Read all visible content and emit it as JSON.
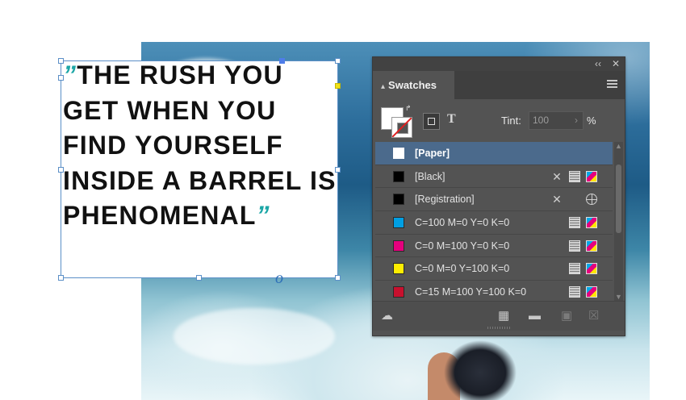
{
  "quote": {
    "open_mark": "”",
    "line1": "THE RUSH YOU",
    "line2": "GET WHEN YOU",
    "line3": "FIND YOURSELF",
    "line4": "INSIDE A BARREL IS",
    "line5": "PHENOMENAL",
    "close_mark": "”",
    "overset_glyph": "o"
  },
  "panel": {
    "title": "Swatches",
    "tint_label": "Tint:",
    "tint_value": "100",
    "tint_unit": "%",
    "text_format_glyph": "T",
    "collapse_glyph": "‹‹",
    "close_glyph": "✕"
  },
  "swatches": [
    {
      "name": "[Paper]",
      "color": "#ffffff",
      "selected": true,
      "icons": []
    },
    {
      "name": "[Black]",
      "color": "#000000",
      "selected": false,
      "icons": [
        "no-edit-icon",
        "process-icon",
        "cmyk-icon"
      ]
    },
    {
      "name": "[Registration]",
      "color": "#000000",
      "selected": false,
      "icons": [
        "no-edit-icon",
        "registration-icon"
      ]
    },
    {
      "name": "C=100 M=0 Y=0 K=0",
      "color": "#009fe3",
      "selected": false,
      "icons": [
        "process-icon",
        "cmyk-icon"
      ]
    },
    {
      "name": "C=0 M=100 Y=0 K=0",
      "color": "#e5007d",
      "selected": false,
      "icons": [
        "process-icon",
        "cmyk-icon"
      ]
    },
    {
      "name": "C=0 M=0 Y=100 K=0",
      "color": "#ffed00",
      "selected": false,
      "icons": [
        "process-icon",
        "cmyk-icon"
      ]
    },
    {
      "name": "C=15 M=100 Y=100 K=0",
      "color": "#c8102e",
      "selected": false,
      "icons": [
        "process-icon",
        "cmyk-icon"
      ]
    }
  ],
  "bottom_icons": [
    "cc-libraries-icon",
    "show-swatch-kinds-icon",
    "new-color-group-icon",
    "new-swatch-icon",
    "delete-swatch-icon"
  ],
  "colors": {
    "panel_bg": "#535353",
    "selection": "#4b6a8c",
    "frame_border": "#5b8fc7",
    "quote_mark": "#1ba6a6"
  }
}
